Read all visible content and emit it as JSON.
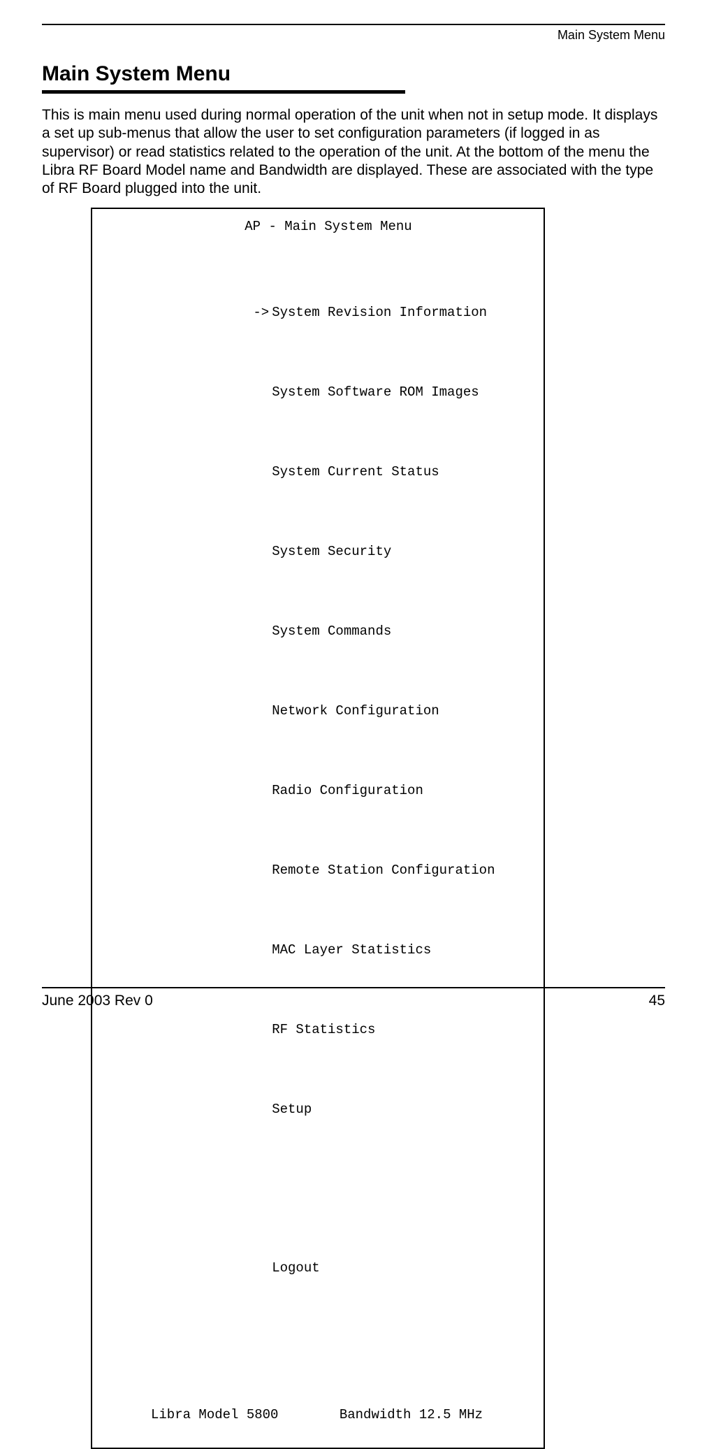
{
  "header": {
    "running_title": "Main System Menu"
  },
  "section": {
    "title": "Main System Menu",
    "paragraph": "This is main menu used during normal operation of the unit when not in setup mode. It displays a set up sub-menus that allow the user to set configuration parameters (if logged in as supervisor) or read statistics related to the operation of the unit. At the bottom of the menu the Libra RF Board Model name and Bandwidth are displayed. These are associated with the type of RF Board plugged into the unit."
  },
  "terminal": {
    "title": "AP - Main System Menu",
    "arrow": "->",
    "menu_items": [
      "System Revision Information",
      "System Software ROM Images",
      "System Current Status",
      "System Security",
      "System Commands",
      "Network Configuration",
      "Radio Configuration",
      "Remote Station Configuration",
      "MAC Layer Statistics",
      "RF Statistics",
      "Setup"
    ],
    "logout_label": "Logout",
    "footer_model": "Libra Model 5800",
    "footer_bandwidth": "Bandwidth 12.5 MHz"
  },
  "footer": {
    "left": "June 2003 Rev 0",
    "right": "45"
  }
}
